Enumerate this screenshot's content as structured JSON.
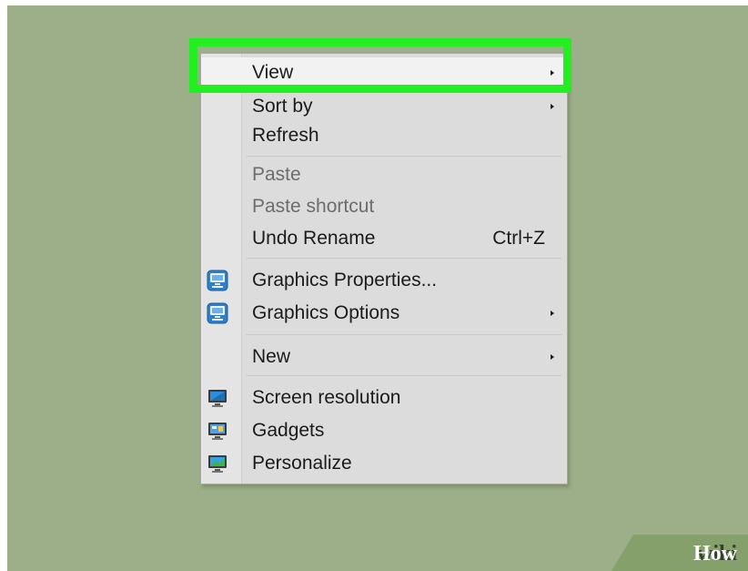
{
  "menu": {
    "view": "View",
    "sort_by": "Sort by",
    "refresh": "Refresh",
    "paste": "Paste",
    "paste_shortcut": "Paste shortcut",
    "undo_rename": "Undo Rename",
    "undo_shortcut": "Ctrl+Z",
    "graphics_properties": "Graphics Properties...",
    "graphics_options": "Graphics Options",
    "new": "New",
    "screen_resolution": "Screen resolution",
    "gadgets": "Gadgets",
    "personalize": "Personalize"
  },
  "colors": {
    "desktop": "#9caf88",
    "highlight": "#22ee22",
    "menu_bg": "#dcdcdc"
  },
  "watermark": {
    "wiki": "wiki",
    "how": "How"
  }
}
